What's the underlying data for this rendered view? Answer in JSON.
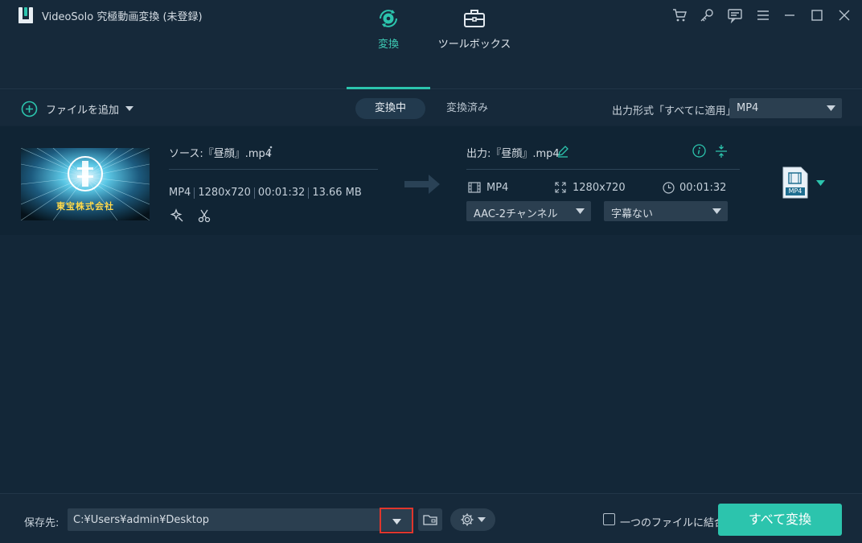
{
  "window": {
    "title": "VideoSolo 究極動画変換 (未登録)",
    "icons": [
      "cart-icon",
      "key-icon",
      "feedback-icon",
      "menu-icon",
      "minimize-icon",
      "maximize-icon",
      "close-icon"
    ]
  },
  "nav": {
    "tabs": [
      {
        "label": "変換",
        "icon": "convert-icon",
        "active": true
      },
      {
        "label": "ツールボックス",
        "icon": "toolbox-icon",
        "active": false
      }
    ]
  },
  "toolbar": {
    "add_file_label": "ファイルを追加",
    "segments": [
      "変換中",
      "変換済み"
    ],
    "output_format_label": "出力形式「すべてに適用」:",
    "output_format_value": "MP4"
  },
  "file": {
    "thumbnail_caption": "東宝株式会社",
    "source_title": "ソース:『昼顔』.mp4",
    "source_meta": [
      "MP4",
      "1280x720",
      "00:01:32",
      "13.66 MB"
    ],
    "output_title": "出力:『昼顔』.mp4",
    "output_format": "MP4",
    "output_resolution": "1280x720",
    "output_duration": "00:01:32",
    "audio_track": "AAC-2チャンネル",
    "subtitle": "字幕ない",
    "format_badge": "MP4"
  },
  "bottom": {
    "save_label": "保存先:",
    "save_path": "C:¥Users¥admin¥Desktop",
    "merge_label": "一つのファイルに結合",
    "merge_checked": false,
    "convert_all_label": "すべて変換"
  },
  "colors": {
    "accent": "#2cc4ad",
    "background": "#132738",
    "highlight_box": "#e0362c"
  }
}
